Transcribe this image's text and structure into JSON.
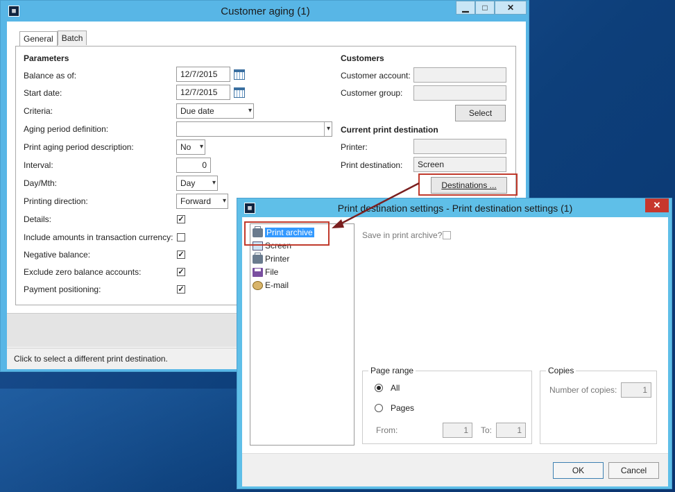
{
  "customer_aging": {
    "title": "Customer aging (1)",
    "window_buttons": {
      "minimize": "▁",
      "maximize": "□",
      "close": "✕"
    },
    "tabs": [
      "General",
      "Batch"
    ],
    "parameters": {
      "heading": "Parameters",
      "balance_as_of": {
        "label": "Balance as of:",
        "value": "12/7/2015"
      },
      "start_date": {
        "label": "Start date:",
        "value": "12/7/2015"
      },
      "criteria": {
        "label": "Criteria:",
        "value": "Due date"
      },
      "aging_period_definition": {
        "label": "Aging period definition:",
        "value": ""
      },
      "print_aging_period_description": {
        "label": "Print aging period description:",
        "value": "No"
      },
      "interval": {
        "label": "Interval:",
        "value": "0"
      },
      "day_mth": {
        "label": "Day/Mth:",
        "value": "Day"
      },
      "printing_direction": {
        "label": "Printing direction:",
        "value": "Forward"
      },
      "details": {
        "label": "Details:",
        "checked": true
      },
      "include_amounts": {
        "label": "Include amounts in transaction currency:",
        "checked": false
      },
      "negative_balance": {
        "label": "Negative balance:",
        "checked": true
      },
      "exclude_zero": {
        "label": "Exclude zero balance accounts:",
        "checked": true
      },
      "payment_positioning": {
        "label": "Payment positioning:",
        "checked": true
      }
    },
    "customers": {
      "heading": "Customers",
      "customer_account": {
        "label": "Customer account:",
        "value": ""
      },
      "customer_group": {
        "label": "Customer group:",
        "value": ""
      },
      "select_button": "Select"
    },
    "current_print_destination": {
      "heading": "Current print destination",
      "printer": {
        "label": "Printer:",
        "value": ""
      },
      "print_destination": {
        "label": "Print destination:",
        "value": "Screen"
      },
      "destinations_button": "Destinations ..."
    },
    "status_text": "Click to select a different print destination."
  },
  "print_destination_settings": {
    "title": "Print destination settings - Print destination settings (1)",
    "close": "✕",
    "destinations": [
      {
        "label": "Print archive",
        "icon": "print-archive-icon",
        "selected": true
      },
      {
        "label": "Screen",
        "icon": "screen-icon",
        "selected": false
      },
      {
        "label": "Printer",
        "icon": "printer-icon",
        "selected": false
      },
      {
        "label": "File",
        "icon": "file-icon",
        "selected": false
      },
      {
        "label": "E-mail",
        "icon": "email-icon",
        "selected": false
      }
    ],
    "save_in_print_archive": {
      "label": "Save in print archive?",
      "checked": false
    },
    "page_range": {
      "title": "Page range",
      "all_label": "All",
      "pages_label": "Pages",
      "selected": "All",
      "from": {
        "label": "From:",
        "value": "1"
      },
      "to": {
        "label": "To:",
        "value": "1"
      }
    },
    "copies": {
      "title": "Copies",
      "number_of_copies": {
        "label": "Number of copies:",
        "value": "1"
      }
    },
    "ok_button": "OK",
    "cancel_button": "Cancel"
  },
  "colors": {
    "title_bar": "#58b6e6",
    "highlight": "#c0392b",
    "selection": "#3399ff",
    "annotation_arrow": "#7a1f1f"
  }
}
